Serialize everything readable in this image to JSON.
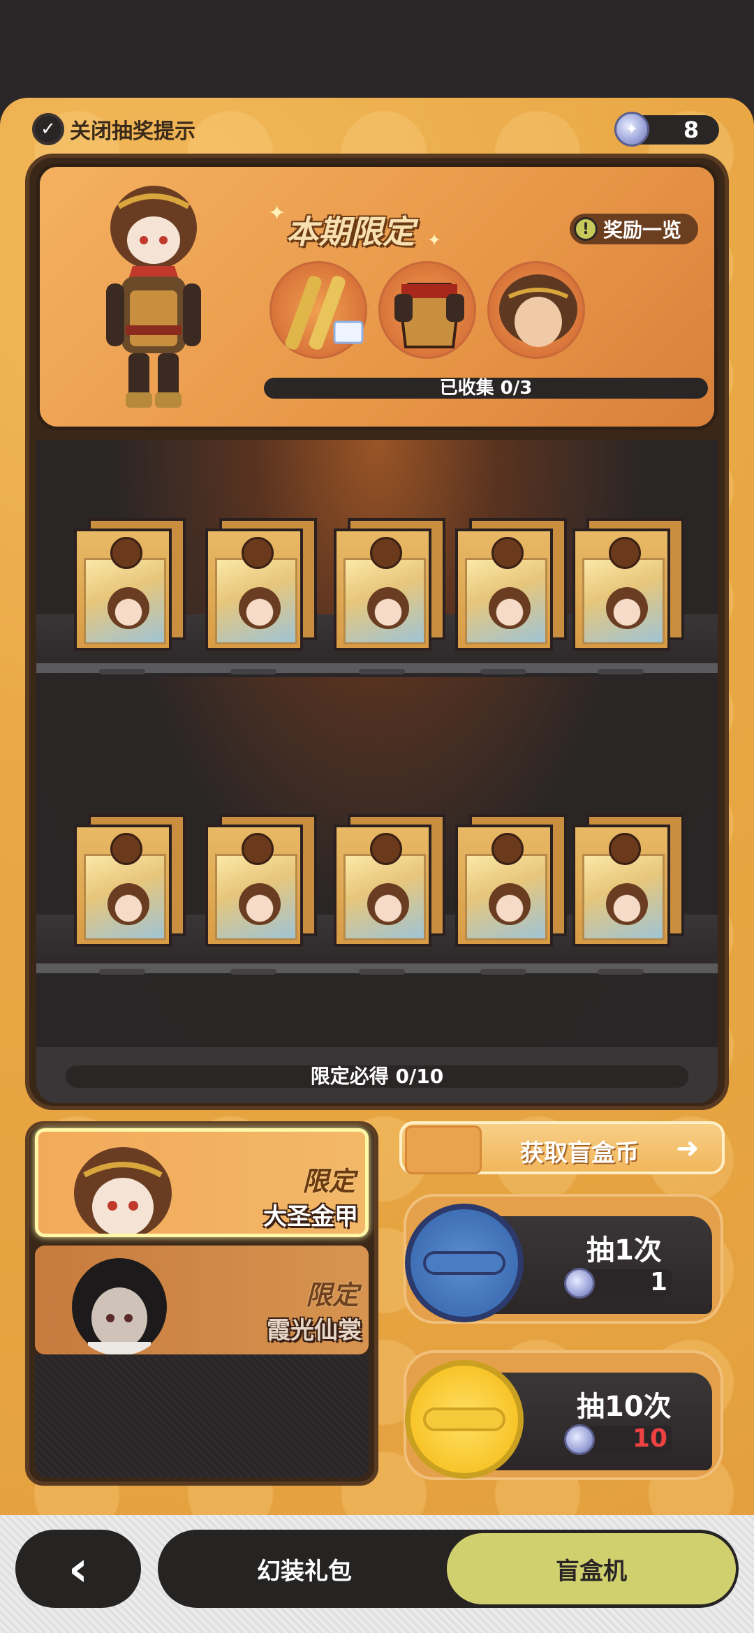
{
  "top_bar": {
    "hint_label": "关闭抽奖提示",
    "coin_count": "8"
  },
  "banner": {
    "title": "本期限定",
    "rewards_button": "奖励一览",
    "reward_items": [
      "golden-staff-icon",
      "armor-icon",
      "hair-icon"
    ],
    "collected": "已收集 0/3"
  },
  "shelves": {
    "rows": 2,
    "boxes_per_row": 5
  },
  "guarantee": "限定必得 0/10",
  "skins": [
    {
      "tag": "限定",
      "name": "大圣金甲",
      "selected": true
    },
    {
      "tag": "限定",
      "name": "霞光仙裳",
      "selected": false
    }
  ],
  "actions": {
    "get_coin_label": "获取盲盒币",
    "draw_once": {
      "label": "抽1次",
      "price": "1"
    },
    "draw_ten": {
      "label": "抽10次",
      "price": "10"
    }
  },
  "nav": {
    "back_icon": "chevron-left-icon",
    "tab_gift": "幻装礼包",
    "tab_blindbox": "盲盒机"
  },
  "colors": {
    "panel_orange": "#e9a845",
    "dark": "#2b2626",
    "active_tab": "#d1d06f",
    "price_red": "#ee4242"
  }
}
